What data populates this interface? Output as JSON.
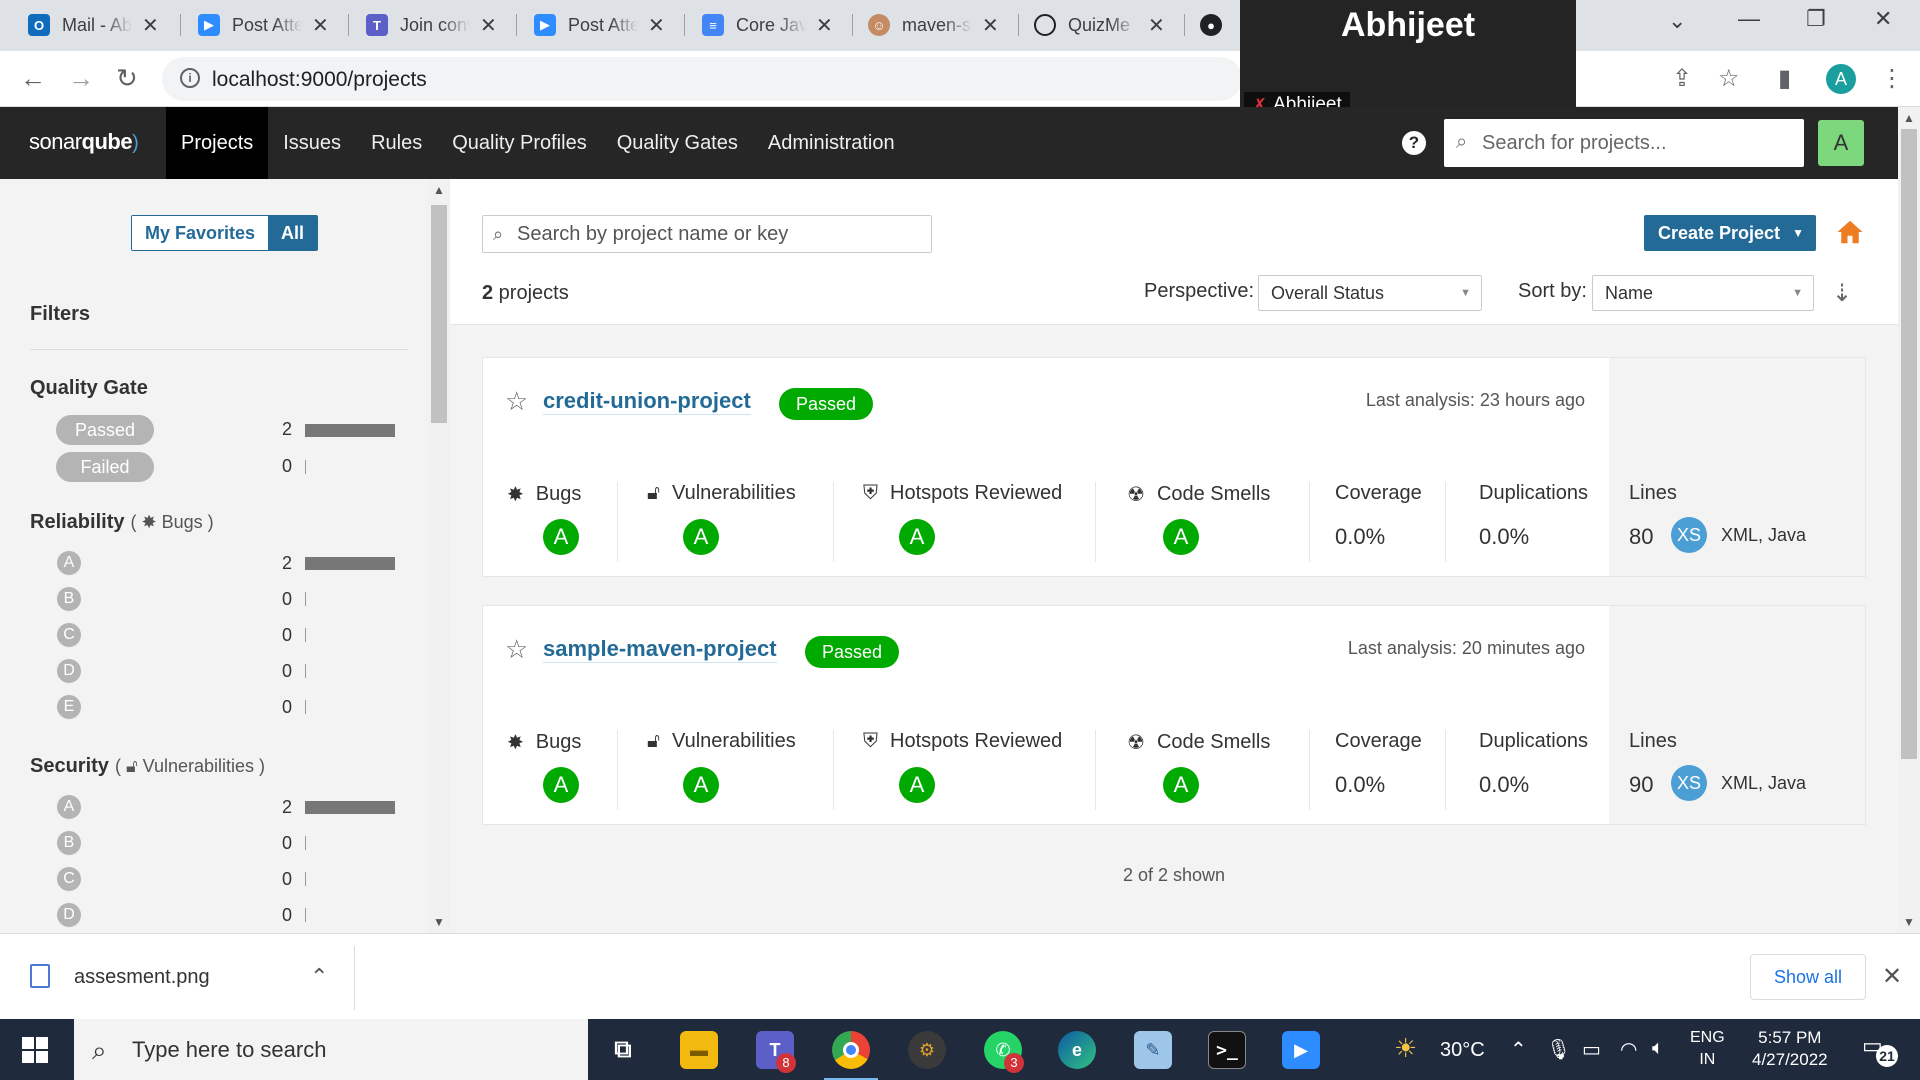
{
  "browser": {
    "tabs": [
      {
        "label": "Mail - Ab",
        "icon": "outlook-icon",
        "color": "#0f6cbd"
      },
      {
        "label": "Post Atte",
        "icon": "zoom-icon",
        "color": "#2d8cff"
      },
      {
        "label": "Join conv",
        "icon": "teams-icon",
        "color": "#5b5fc7"
      },
      {
        "label": "Post Atte",
        "icon": "zoom-icon",
        "color": "#2d8cff"
      },
      {
        "label": "Core Jav",
        "icon": "docs-icon",
        "color": "#4285f4"
      },
      {
        "label": "maven-s",
        "icon": "avatar-icon",
        "color": "#c58b62"
      },
      {
        "label": "QuizMe",
        "icon": "circle-icon",
        "color": "#202124"
      }
    ],
    "url": "localhost:9000/projects"
  },
  "zoom_overlay": {
    "participant_big": "Abhijeet",
    "participant_small": "Abhijeet"
  },
  "sonar": {
    "logo_a": "sonar",
    "logo_b": "qube",
    "menu": [
      "Projects",
      "Issues",
      "Rules",
      "Quality Profiles",
      "Quality Gates",
      "Administration"
    ],
    "search_placeholder": "Search for projects...",
    "user_initial": "A"
  },
  "sidebar": {
    "toggle": {
      "favorites": "My Favorites",
      "all": "All"
    },
    "filters_title": "Filters",
    "quality_gate": {
      "title": "Quality Gate",
      "options": [
        {
          "label": "Passed",
          "count": "2",
          "fraction": 1.0
        },
        {
          "label": "Failed",
          "count": "0",
          "fraction": 0
        }
      ]
    },
    "reliability": {
      "title": "Reliability",
      "sub": "Bugs",
      "ratings": [
        {
          "label": "A",
          "count": "2",
          "fraction": 1.0
        },
        {
          "label": "B",
          "count": "0",
          "fraction": 0
        },
        {
          "label": "C",
          "count": "0",
          "fraction": 0
        },
        {
          "label": "D",
          "count": "0",
          "fraction": 0
        },
        {
          "label": "E",
          "count": "0",
          "fraction": 0
        }
      ]
    },
    "security": {
      "title": "Security",
      "sub": "Vulnerabilities",
      "ratings": [
        {
          "label": "A",
          "count": "2",
          "fraction": 1.0
        },
        {
          "label": "B",
          "count": "0",
          "fraction": 0
        },
        {
          "label": "C",
          "count": "0",
          "fraction": 0
        },
        {
          "label": "D",
          "count": "0",
          "fraction": 0
        }
      ]
    }
  },
  "main": {
    "search_placeholder": "Search by project name or key",
    "create_label": "Create Project",
    "count_num": "2",
    "count_text": " projects",
    "perspective_label": "Perspective:",
    "perspective_value": "Overall Status",
    "sort_label": "Sort by:",
    "sort_value": "Name",
    "metric_labels": {
      "bugs": "Bugs",
      "vulnerabilities": "Vulnerabilities",
      "hotspots": "Hotspots Reviewed",
      "smells": "Code Smells",
      "coverage": "Coverage",
      "duplications": "Duplications",
      "lines": "Lines"
    },
    "projects": [
      {
        "name": "credit-union-project",
        "gate": "Passed",
        "last_analysis": "Last analysis: 23 hours ago",
        "bugs": "A",
        "vulnerabilities": "A",
        "hotspots": "A",
        "smells": "A",
        "coverage": "0.0%",
        "duplications": "0.0%",
        "lines": "80",
        "size": "XS",
        "languages": "XML, Java"
      },
      {
        "name": "sample-maven-project",
        "gate": "Passed",
        "last_analysis": "Last analysis: 20 minutes ago",
        "bugs": "A",
        "vulnerabilities": "A",
        "hotspots": "A",
        "smells": "A",
        "coverage": "0.0%",
        "duplications": "0.0%",
        "lines": "90",
        "size": "XS",
        "languages": "XML, Java"
      }
    ],
    "shown": "2 of 2 shown"
  },
  "downloads": {
    "file": "assesment.png",
    "show_all": "Show all"
  },
  "taskbar": {
    "search_text": "Type here to search",
    "teams_badge": "8",
    "whatsapp_badge": "3",
    "temperature": "30°C",
    "lang_a": "ENG",
    "lang_b": "IN",
    "time": "5:57 PM",
    "date": "4/27/2022",
    "notifications": "21"
  },
  "colors": {
    "accent": "#236a97",
    "passed": "#00aa00",
    "nav_bg": "#262626"
  }
}
